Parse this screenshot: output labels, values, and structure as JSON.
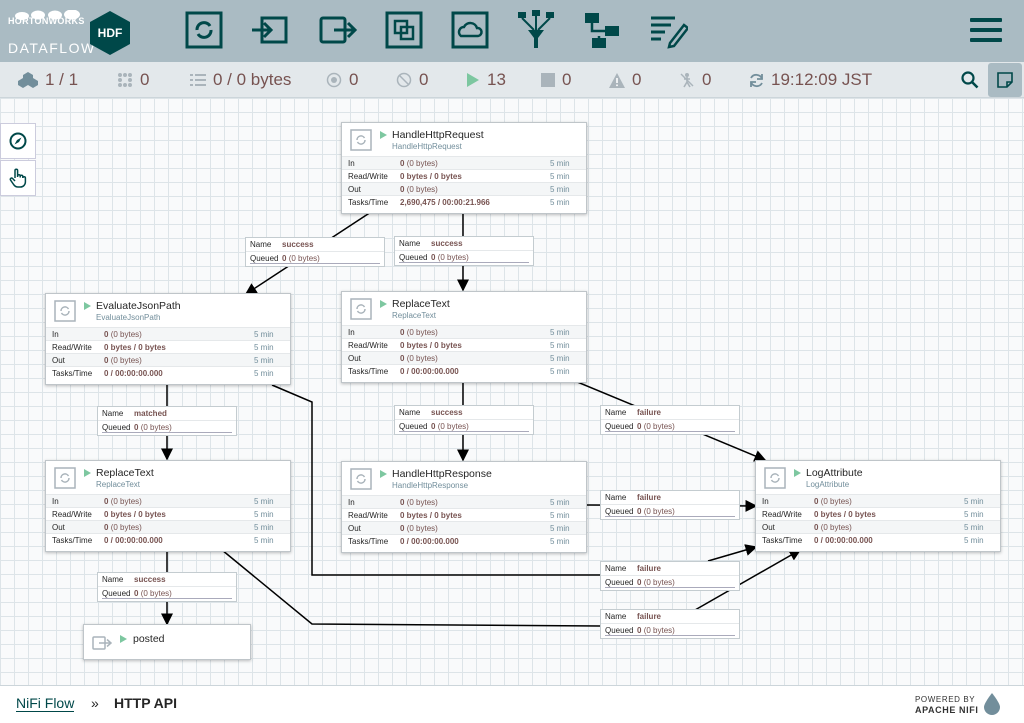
{
  "brand": {
    "company": "HORTONWORKS",
    "product": "DATAFLOW",
    "badge": "HDF"
  },
  "toolbar": {
    "items": [
      "processor-icon",
      "input-port-icon",
      "output-port-icon",
      "process-group-icon",
      "remote-process-group-icon",
      "funnel-icon",
      "template-icon",
      "label-icon"
    ]
  },
  "status": {
    "cluster": "1 / 1",
    "transmitting": "0",
    "queued": "0 / 0 bytes",
    "not_transmitting": "0",
    "disabled": "0",
    "running": "13",
    "stopped": "0",
    "invalid": "0",
    "disabled_components": "0",
    "last_refreshed": "19:12:09 JST"
  },
  "colors": {
    "header": "#aabbc3",
    "accent": "#004849",
    "value": "#775351",
    "running": "#7dc7a0"
  },
  "processors": [
    {
      "id": "handlehttprequest",
      "name": "HandleHttpRequest",
      "type": "HandleHttpRequest",
      "in_count": "0",
      "in_bytes": "(0 bytes)",
      "readwrite": "0 bytes / 0 bytes",
      "out_count": "0",
      "out_bytes": "(0 bytes)",
      "tasks": "2,690,475 / 00:00:21.966",
      "period": "5 min"
    },
    {
      "id": "evaluatejsonpath",
      "name": "EvaluateJsonPath",
      "type": "EvaluateJsonPath",
      "in_count": "0",
      "in_bytes": "(0 bytes)",
      "readwrite": "0 bytes / 0 bytes",
      "out_count": "0",
      "out_bytes": "(0 bytes)",
      "tasks": "0 / 00:00:00.000",
      "period": "5 min"
    },
    {
      "id": "replacetext1",
      "name": "ReplaceText",
      "type": "ReplaceText",
      "in_count": "0",
      "in_bytes": "(0 bytes)",
      "readwrite": "0 bytes / 0 bytes",
      "out_count": "0",
      "out_bytes": "(0 bytes)",
      "tasks": "0 / 00:00:00.000",
      "period": "5 min"
    },
    {
      "id": "replacetext2",
      "name": "ReplaceText",
      "type": "ReplaceText",
      "in_count": "0",
      "in_bytes": "(0 bytes)",
      "readwrite": "0 bytes / 0 bytes",
      "out_count": "0",
      "out_bytes": "(0 bytes)",
      "tasks": "0 / 00:00:00.000",
      "period": "5 min"
    },
    {
      "id": "handlehttpresponse",
      "name": "HandleHttpResponse",
      "type": "HandleHttpResponse",
      "in_count": "0",
      "in_bytes": "(0 bytes)",
      "readwrite": "0 bytes / 0 bytes",
      "out_count": "0",
      "out_bytes": "(0 bytes)",
      "tasks": "0 / 00:00:00.000",
      "period": "5 min"
    },
    {
      "id": "logattribute",
      "name": "LogAttribute",
      "type": "LogAttribute",
      "in_count": "0",
      "in_bytes": "(0 bytes)",
      "readwrite": "0 bytes / 0 bytes",
      "out_count": "0",
      "out_bytes": "(0 bytes)",
      "tasks": "0 / 00:00:00.000",
      "period": "5 min"
    }
  ],
  "row_labels": {
    "in": "In",
    "readwrite": "Read/Write",
    "out": "Out",
    "tasks": "Tasks/Time"
  },
  "conn_keys": {
    "name": "Name",
    "queued": "Queued"
  },
  "connections": [
    {
      "id": "c1",
      "name": "success",
      "queued_count": "0",
      "queued_bytes": "(0 bytes)"
    },
    {
      "id": "c2",
      "name": "success",
      "queued_count": "0",
      "queued_bytes": "(0 bytes)"
    },
    {
      "id": "c3",
      "name": "matched",
      "queued_count": "0",
      "queued_bytes": "(0 bytes)"
    },
    {
      "id": "c4",
      "name": "success",
      "queued_count": "0",
      "queued_bytes": "(0 bytes)"
    },
    {
      "id": "c5",
      "name": "failure",
      "queued_count": "0",
      "queued_bytes": "(0 bytes)"
    },
    {
      "id": "c6",
      "name": "failure",
      "queued_count": "0",
      "queued_bytes": "(0 bytes)"
    },
    {
      "id": "c7",
      "name": "success",
      "queued_count": "0",
      "queued_bytes": "(0 bytes)"
    },
    {
      "id": "c8",
      "name": "failure",
      "queued_count": "0",
      "queued_bytes": "(0 bytes)"
    },
    {
      "id": "c9",
      "name": "failure",
      "queued_count": "0",
      "queued_bytes": "(0 bytes)"
    }
  ],
  "output_port": {
    "name": "posted"
  },
  "breadcrumb": {
    "root": "NiFi Flow",
    "sep": "»",
    "current": "HTTP API"
  },
  "footer": {
    "powered_by": "POWERED BY",
    "apache_nifi": "APACHE NIFI"
  }
}
